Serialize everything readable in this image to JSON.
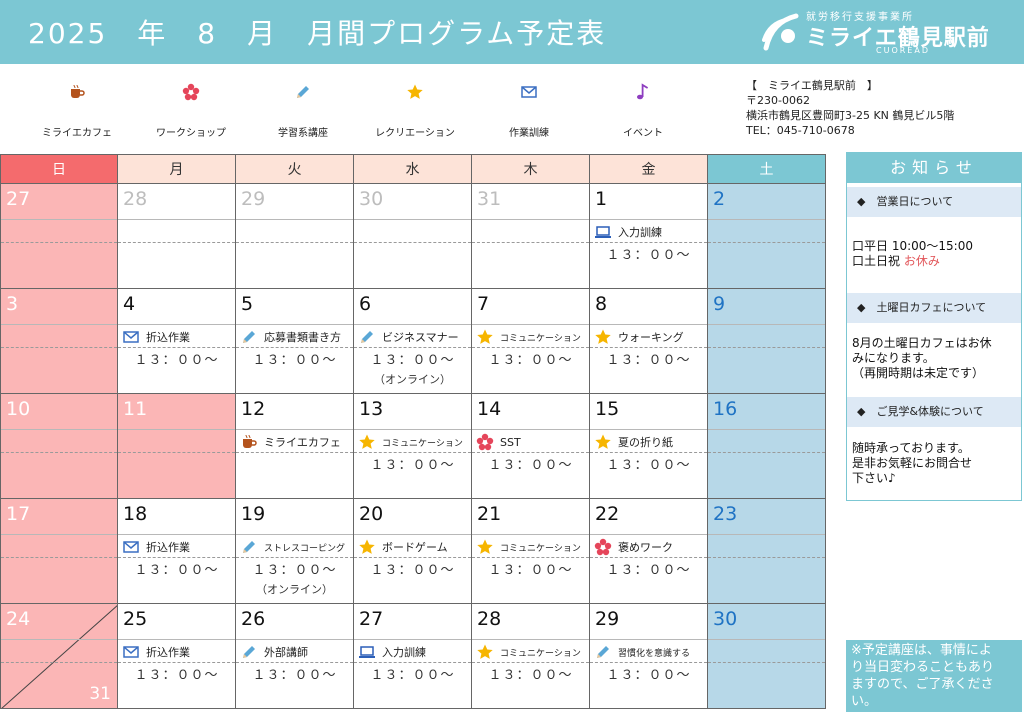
{
  "header": {
    "title": "2025　年　8　月　月間プログラム予定表",
    "logo": {
      "sub": "就労移行支援事業所",
      "name": "ミライエ鶴見駅前",
      "en": "CUOREAD",
      "accent": "#ffffff"
    },
    "bg_color": "#7cc7d3"
  },
  "legend": [
    {
      "icon": "coffee-icon",
      "label": "ミライエカフェ"
    },
    {
      "icon": "flower-icon",
      "label": "ワークショップ"
    },
    {
      "icon": "pencil-icon",
      "label": "学習系講座"
    },
    {
      "icon": "star-icon",
      "label": "レクリエーション"
    },
    {
      "icon": "envelope-icon",
      "label": "作業訓練"
    },
    {
      "icon": "music-note-icon",
      "label": "イベント"
    }
  ],
  "address": {
    "name": "【　ミライエ鶴見駅前　】",
    "zip": "〒230-0062",
    "street": "横浜市鶴見区豊岡町3-25 KN 鶴見ビル5階",
    "tel": "TEL：045-710-0678"
  },
  "weekdays": [
    "日",
    "月",
    "火",
    "水",
    "木",
    "金",
    "土"
  ],
  "weeks": [
    [
      {
        "day": "27",
        "gray": false
      },
      {
        "day": "28",
        "gray": true
      },
      {
        "day": "29",
        "gray": true
      },
      {
        "day": "30",
        "gray": true
      },
      {
        "day": "31",
        "gray": true
      },
      {
        "day": "1",
        "event": {
          "icon": "laptop-icon",
          "name": "入力訓練",
          "time": "１３：００～"
        }
      },
      {
        "day": "2"
      }
    ],
    [
      {
        "day": "3"
      },
      {
        "day": "4",
        "event": {
          "icon": "envelope-icon",
          "name": "折込作業",
          "time": "１３：００～"
        }
      },
      {
        "day": "5",
        "event": {
          "icon": "pencil-icon",
          "name": "応募書類書き方",
          "time": "１３：００～"
        }
      },
      {
        "day": "6",
        "event": {
          "icon": "pencil-icon",
          "name": "ビジネスマナー",
          "time": "１３：００～",
          "note": "（オンライン）"
        }
      },
      {
        "day": "7",
        "event": {
          "icon": "star-icon",
          "name": "コミュニケーション",
          "small": true,
          "time": "１３：００～"
        }
      },
      {
        "day": "8",
        "event": {
          "icon": "star-icon",
          "name": "ウォーキング",
          "time": "１３：００～"
        }
      },
      {
        "day": "9"
      }
    ],
    [
      {
        "day": "10"
      },
      {
        "day": "11",
        "holiday": true
      },
      {
        "day": "12",
        "event": {
          "icon": "coffee-icon",
          "name": "ミライエカフェ"
        }
      },
      {
        "day": "13",
        "event": {
          "icon": "star-icon",
          "name": "コミュニケーション",
          "small": true,
          "time": "１３：００～"
        }
      },
      {
        "day": "14",
        "event": {
          "icon": "flower-icon",
          "name": "SST",
          "time": "１３：００～"
        }
      },
      {
        "day": "15",
        "event": {
          "icon": "star-icon",
          "name": "夏の折り紙",
          "time": "１３：００～"
        }
      },
      {
        "day": "16"
      }
    ],
    [
      {
        "day": "17"
      },
      {
        "day": "18",
        "event": {
          "icon": "envelope-icon",
          "name": "折込作業",
          "time": "１３：００～"
        }
      },
      {
        "day": "19",
        "event": {
          "icon": "pencil-icon",
          "name": "ストレスコーピング",
          "small": true,
          "time": "１３：００～",
          "note": "（オンライン）"
        }
      },
      {
        "day": "20",
        "event": {
          "icon": "star-icon",
          "name": "ボードゲーム",
          "time": "１３：００～"
        }
      },
      {
        "day": "21",
        "event": {
          "icon": "star-icon",
          "name": "コミュニケーション",
          "small": true,
          "time": "１３：００～"
        }
      },
      {
        "day": "22",
        "event": {
          "icon": "flower-icon",
          "name": "褒めワーク",
          "time": "１３：００～"
        }
      },
      {
        "day": "23"
      }
    ],
    [
      {
        "day": "24",
        "day2": "31"
      },
      {
        "day": "25",
        "event": {
          "icon": "envelope-icon",
          "name": "折込作業",
          "time": "１３：００～"
        }
      },
      {
        "day": "26",
        "event": {
          "icon": "pencil-icon",
          "name": "外部講師",
          "time": "１３：００～"
        }
      },
      {
        "day": "27",
        "event": {
          "icon": "laptop-icon",
          "name": "入力訓練",
          "time": "１３：００～"
        }
      },
      {
        "day": "28",
        "event": {
          "icon": "star-icon",
          "name": "コミュニケーション",
          "small": true,
          "time": "１３：００～"
        }
      },
      {
        "day": "29",
        "event": {
          "icon": "pencil-icon",
          "name": "習慣化を意識する",
          "small": true,
          "time": "１３：００～"
        }
      },
      {
        "day": "30"
      }
    ]
  ],
  "notice": {
    "title": "お知らせ",
    "sections": [
      {
        "heading": "◆　営業日について",
        "lines": [
          "口平日 10:00～15:00"
        ],
        "line2_prefix": "口土日祝 ",
        "line2_red": "お休み"
      },
      {
        "heading": "◆　土曜日カフェについて",
        "lines": [
          "8月の土曜日カフェはお休",
          "みになります。",
          "（再開時期は未定です）"
        ]
      },
      {
        "heading": "◆　ご見学&体験について",
        "lines": [
          "随時承っております。",
          "是非お気軽にお問合せ",
          "下さい♪"
        ]
      }
    ]
  },
  "footnote": [
    "※予定講座は、事情によ",
    "り当日変わることもあり",
    "ますので、ご了承くださ",
    "い。"
  ],
  "colors": {
    "teal": "#7cc7d3",
    "sunday": "#f46b6d",
    "sunday_cell": "#fbb6b6",
    "saturday_cell": "#b7d8e8",
    "weekday_header": "#fde3d8"
  }
}
